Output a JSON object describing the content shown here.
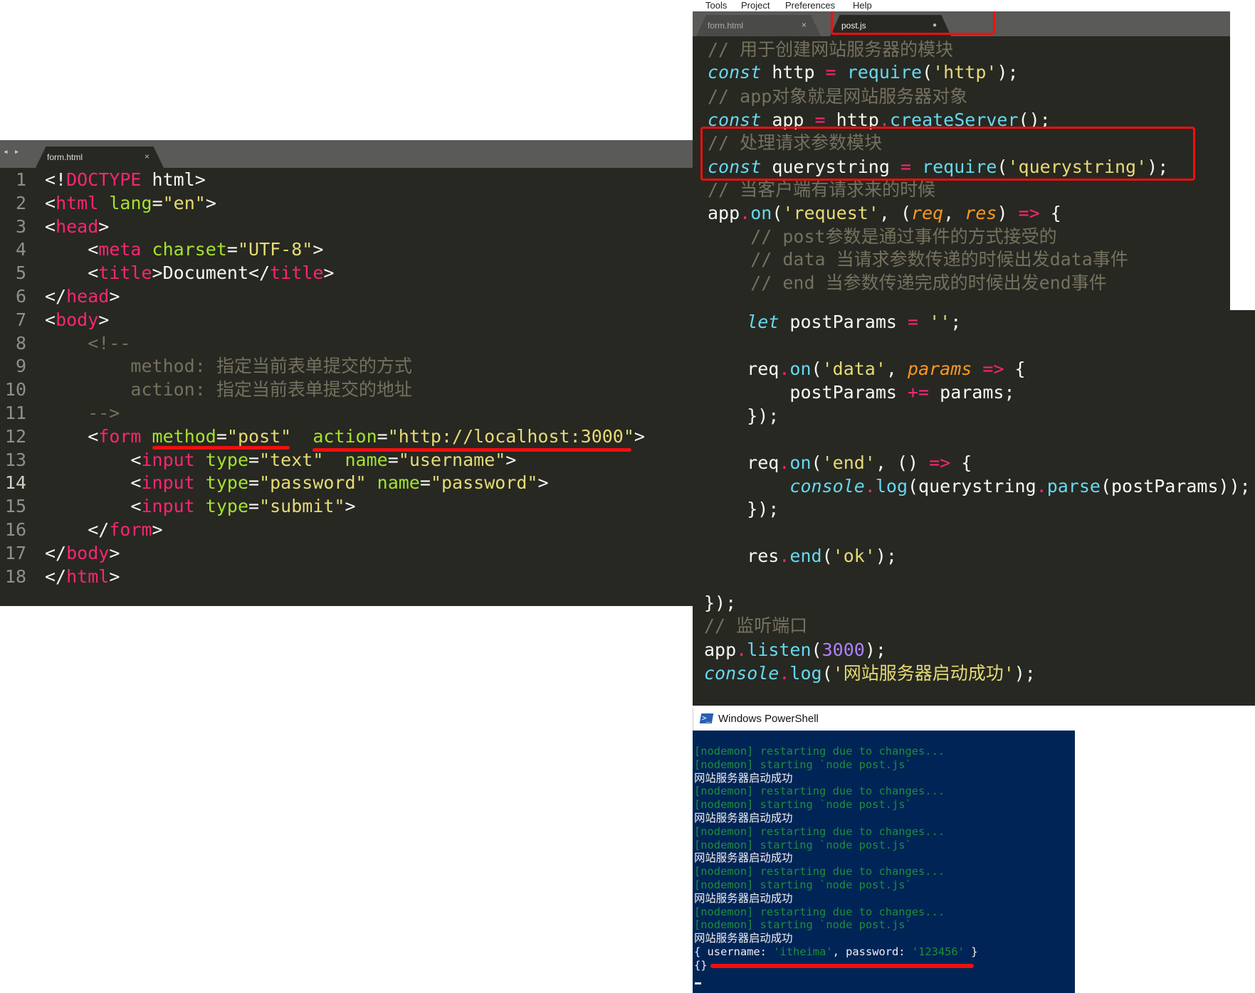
{
  "menu": {
    "items": [
      "Tools",
      "Project",
      "Preferences",
      "Help"
    ]
  },
  "left_editor": {
    "tabs": [
      {
        "label": "form.html",
        "close": "×"
      }
    ],
    "nav_arrows": "◂ ▸",
    "active_line": 14,
    "lines": [
      [
        [
          "<!",
          "p"
        ],
        [
          "DOCTYPE",
          "k"
        ],
        [
          " html>",
          "p"
        ]
      ],
      [
        [
          "<",
          "p"
        ],
        [
          "html",
          "k"
        ],
        [
          " ",
          "p"
        ],
        [
          "lang",
          "g"
        ],
        [
          "=",
          "p"
        ],
        [
          "\"en\"",
          "s"
        ],
        [
          ">",
          "p"
        ]
      ],
      [
        [
          "<",
          "p"
        ],
        [
          "head",
          "k"
        ],
        [
          ">",
          "p"
        ]
      ],
      [
        [
          "    <",
          "p"
        ],
        [
          "meta",
          "k"
        ],
        [
          " ",
          "p"
        ],
        [
          "charset",
          "g"
        ],
        [
          "=",
          "p"
        ],
        [
          "\"UTF-8\"",
          "s"
        ],
        [
          ">",
          "p"
        ]
      ],
      [
        [
          "    <",
          "p"
        ],
        [
          "title",
          "k"
        ],
        [
          ">Document</",
          "p"
        ],
        [
          "title",
          "k"
        ],
        [
          ">",
          "p"
        ]
      ],
      [
        [
          "</",
          "p"
        ],
        [
          "head",
          "k"
        ],
        [
          ">",
          "p"
        ]
      ],
      [
        [
          "<",
          "p"
        ],
        [
          "body",
          "k"
        ],
        [
          ">",
          "p"
        ]
      ],
      [
        [
          "    <!--",
          "c"
        ]
      ],
      [
        [
          "        method: 指定当前表单提交的方式",
          "c"
        ]
      ],
      [
        [
          "        action: 指定当前表单提交的地址",
          "c"
        ]
      ],
      [
        [
          "    -->",
          "c"
        ]
      ],
      [
        [
          "    <",
          "p"
        ],
        [
          "form",
          "k"
        ],
        [
          " ",
          "p"
        ],
        [
          "method",
          "g"
        ],
        [
          "=",
          "p"
        ],
        [
          "\"post\"",
          "s"
        ],
        [
          "  ",
          "p"
        ],
        [
          "action",
          "g"
        ],
        [
          "=",
          "p"
        ],
        [
          "\"http://localhost:3000\"",
          "s"
        ],
        [
          ">",
          "p"
        ]
      ],
      [
        [
          "        <",
          "p"
        ],
        [
          "input",
          "k"
        ],
        [
          " ",
          "p"
        ],
        [
          "type",
          "g"
        ],
        [
          "=",
          "p"
        ],
        [
          "\"text\"",
          "s"
        ],
        [
          "  ",
          "p"
        ],
        [
          "name",
          "g"
        ],
        [
          "=",
          "p"
        ],
        [
          "\"username\"",
          "s"
        ],
        [
          ">",
          "p"
        ]
      ],
      [
        [
          "        <",
          "p"
        ],
        [
          "input",
          "k"
        ],
        [
          " ",
          "p"
        ],
        [
          "type",
          "g"
        ],
        [
          "=",
          "p"
        ],
        [
          "\"password\"",
          "s"
        ],
        [
          " ",
          "p"
        ],
        [
          "name",
          "g"
        ],
        [
          "=",
          "p"
        ],
        [
          "\"password\"",
          "s"
        ],
        [
          ">",
          "p"
        ]
      ],
      [
        [
          "        <",
          "p"
        ],
        [
          "input",
          "k"
        ],
        [
          " ",
          "p"
        ],
        [
          "type",
          "g"
        ],
        [
          "=",
          "p"
        ],
        [
          "\"submit\"",
          "s"
        ],
        [
          ">",
          "p"
        ]
      ],
      [
        [
          "    </",
          "p"
        ],
        [
          "form",
          "k"
        ],
        [
          ">",
          "p"
        ]
      ],
      [
        [
          "</",
          "p"
        ],
        [
          "body",
          "k"
        ],
        [
          ">",
          "p"
        ]
      ],
      [
        [
          "</",
          "p"
        ],
        [
          "html",
          "k"
        ],
        [
          ">",
          "p"
        ]
      ]
    ]
  },
  "right_editor": {
    "tabs": [
      {
        "label": "form.html",
        "close": "×",
        "active": false
      },
      {
        "label": "post.js",
        "close": "●",
        "active": true
      }
    ],
    "lines": [
      [
        [
          "// 用于创建网站服务器的模块",
          "c"
        ]
      ],
      [
        [
          "const",
          "i"
        ],
        [
          " http ",
          "p"
        ],
        [
          "=",
          "k"
        ],
        [
          " ",
          "p"
        ],
        [
          "require",
          "f"
        ],
        [
          "(",
          "p"
        ],
        [
          "'http'",
          "s"
        ],
        [
          ");",
          "p"
        ]
      ],
      [
        [
          "// app对象就是网站服务器对象",
          "c"
        ]
      ],
      [
        [
          "const",
          "i"
        ],
        [
          " app ",
          "p"
        ],
        [
          "=",
          "k"
        ],
        [
          " http",
          "p"
        ],
        [
          ".",
          "k"
        ],
        [
          "createServer",
          "f"
        ],
        [
          "();",
          "p"
        ]
      ],
      [
        [
          "// 处理请求参数模块",
          "c"
        ]
      ],
      [
        [
          "const",
          "i"
        ],
        [
          " querystring ",
          "p"
        ],
        [
          "=",
          "k"
        ],
        [
          " ",
          "p"
        ],
        [
          "require",
          "f"
        ],
        [
          "(",
          "p"
        ],
        [
          "'querystring'",
          "s"
        ],
        [
          ");",
          "p"
        ]
      ],
      [
        [
          "// 当客户端有请求来的时候",
          "c"
        ]
      ],
      [
        [
          "app",
          "p"
        ],
        [
          ".",
          "k"
        ],
        [
          "on",
          "f"
        ],
        [
          "(",
          "p"
        ],
        [
          "'request'",
          "s"
        ],
        [
          ", (",
          "p"
        ],
        [
          "req",
          "o"
        ],
        [
          ", ",
          "p"
        ],
        [
          "res",
          "o"
        ],
        [
          ") ",
          "p"
        ],
        [
          "=>",
          "k"
        ],
        [
          " {",
          "p"
        ]
      ],
      [
        [
          "    // post参数是通过事件的方式接受的",
          "c"
        ]
      ],
      [
        [
          "    // data 当请求参数传递的时候出发data事件",
          "c"
        ]
      ],
      [
        [
          "    // end 当参数传递完成的时候出发end事件",
          "c"
        ]
      ],
      [
        [
          "    ",
          "p"
        ],
        [
          "let",
          "i"
        ],
        [
          " postParams ",
          "p"
        ],
        [
          "=",
          "k"
        ],
        [
          " ",
          "p"
        ],
        [
          "''",
          "s"
        ],
        [
          ";",
          "p"
        ]
      ],
      [
        [
          "    req",
          "p"
        ],
        [
          ".",
          "k"
        ],
        [
          "on",
          "f"
        ],
        [
          "(",
          "p"
        ],
        [
          "'data'",
          "s"
        ],
        [
          ", ",
          "p"
        ],
        [
          "params",
          "o"
        ],
        [
          " ",
          "p"
        ],
        [
          "=>",
          "k"
        ],
        [
          " {",
          "p"
        ]
      ],
      [
        [
          "        postParams ",
          "p"
        ],
        [
          "+=",
          "k"
        ],
        [
          " params;",
          "p"
        ]
      ],
      [
        [
          "    });",
          "p"
        ]
      ],
      [
        [
          "    req",
          "p"
        ],
        [
          ".",
          "k"
        ],
        [
          "on",
          "f"
        ],
        [
          "(",
          "p"
        ],
        [
          "'end'",
          "s"
        ],
        [
          ", () ",
          "p"
        ],
        [
          "=>",
          "k"
        ],
        [
          " {",
          "p"
        ]
      ],
      [
        [
          "        ",
          "p"
        ],
        [
          "console",
          "i"
        ],
        [
          ".",
          "k"
        ],
        [
          "log",
          "f"
        ],
        [
          "(querystring",
          "p"
        ],
        [
          ".",
          "k"
        ],
        [
          "parse",
          "f"
        ],
        [
          "(postParams));",
          "p"
        ]
      ],
      [
        [
          "    });",
          "p"
        ]
      ],
      [
        [
          "    res",
          "p"
        ],
        [
          ".",
          "k"
        ],
        [
          "end",
          "f"
        ],
        [
          "(",
          "p"
        ],
        [
          "'ok'",
          "s"
        ],
        [
          ");",
          "p"
        ]
      ],
      [
        [
          "});",
          "p"
        ]
      ],
      [
        [
          "// 监听端口",
          "c"
        ]
      ],
      [
        [
          "app",
          "p"
        ],
        [
          ".",
          "k"
        ],
        [
          "listen",
          "f"
        ],
        [
          "(",
          "p"
        ],
        [
          "3000",
          "n"
        ],
        [
          ");",
          "p"
        ]
      ],
      [
        [
          "console",
          "i"
        ],
        [
          ".",
          "k"
        ],
        [
          "log",
          "f"
        ],
        [
          "(",
          "p"
        ],
        [
          "'网站服务器启动成功'",
          "s"
        ],
        [
          ");",
          "p"
        ]
      ]
    ]
  },
  "terminal": {
    "title": "Windows PowerShell",
    "lines": [
      [
        [
          "[nodemon] restarting due to changes...",
          "tg"
        ]
      ],
      [
        [
          "[nodemon] starting `node post.js`",
          "tg"
        ]
      ],
      [
        [
          "网站服务器启动成功",
          "tw"
        ]
      ],
      [
        [
          "[nodemon] restarting due to changes...",
          "tg"
        ]
      ],
      [
        [
          "[nodemon] starting `node post.js`",
          "tg"
        ]
      ],
      [
        [
          "网站服务器启动成功",
          "tw"
        ]
      ],
      [
        [
          "[nodemon] restarting due to changes...",
          "tg"
        ]
      ],
      [
        [
          "[nodemon] starting `node post.js`",
          "tg"
        ]
      ],
      [
        [
          "网站服务器启动成功",
          "tw"
        ]
      ],
      [
        [
          "[nodemon] restarting due to changes...",
          "tg"
        ]
      ],
      [
        [
          "[nodemon] starting `node post.js`",
          "tg"
        ]
      ],
      [
        [
          "网站服务器启动成功",
          "tw"
        ]
      ],
      [
        [
          "[nodemon] restarting due to changes...",
          "tg"
        ]
      ],
      [
        [
          "[nodemon] starting `node post.js`",
          "tg"
        ]
      ],
      [
        [
          "网站服务器启动成功",
          "tw"
        ]
      ],
      [
        [
          "{ username: ",
          "tw"
        ],
        [
          "'itheima'",
          "tg"
        ],
        [
          ", password: ",
          "tw"
        ],
        [
          "'123456'",
          "tg"
        ],
        [
          " }",
          "tw"
        ]
      ],
      [
        [
          "{}",
          "tw"
        ]
      ]
    ]
  },
  "colors": {
    "editor_bg": "#272822",
    "terminal_bg": "#012456",
    "annotation": "#f01010"
  }
}
